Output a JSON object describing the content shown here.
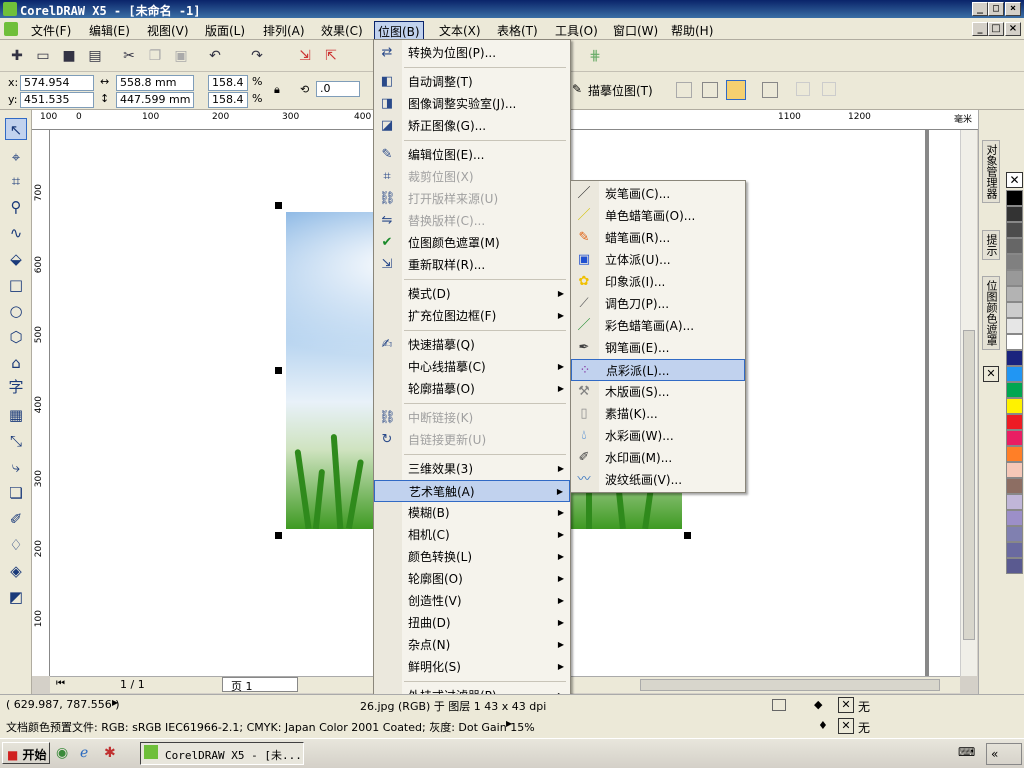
{
  "window": {
    "title": "CorelDRAW X5 - [未命名 -1]"
  },
  "menubar": [
    "文件(F)",
    "编辑(E)",
    "视图(V)",
    "版面(L)",
    "排列(A)",
    "效果(C)",
    "位图(B)",
    "文本(X)",
    "表格(T)",
    "工具(O)",
    "窗口(W)",
    "帮助(H)"
  ],
  "propbar": {
    "x": "574.954 mm",
    "y": "451.535 mm",
    "w": "558.8 mm",
    "h": "447.599 mm",
    "sx": "158.4",
    "sy": "158.4",
    "pct": "%",
    "rot": ".0",
    "trace": "描摹位图(T)"
  },
  "ruler_h": [
    "100",
    "0",
    "100",
    "200",
    "300",
    "400",
    "1100",
    "1200",
    "毫米"
  ],
  "ruler_v": [
    "700",
    "600",
    "500",
    "400",
    "300",
    "200",
    "100"
  ],
  "bitmap_menu": [
    {
      "label": "转换为位图(P)...",
      "icon": "convert-icon",
      "state": "normal"
    },
    {
      "label": "自动调整(T)",
      "icon": "auto-adjust-icon",
      "state": "normal"
    },
    {
      "label": "图像调整实验室(J)...",
      "icon": "image-lab-icon",
      "state": "normal"
    },
    {
      "label": "矫正图像(G)...",
      "icon": "straighten-icon",
      "state": "normal"
    },
    {
      "label": "编辑位图(E)...",
      "icon": "edit-bitmap-icon",
      "state": "normal"
    },
    {
      "label": "裁剪位图(X)",
      "icon": "crop-icon",
      "state": "disabled"
    },
    {
      "label": "打开版样来源(U)",
      "icon": "link-icon",
      "state": "disabled"
    },
    {
      "label": "替换版样(C)...",
      "icon": "replace-icon",
      "state": "disabled"
    },
    {
      "label": "位图颜色遮罩(M)",
      "icon": "check-icon",
      "state": "normal"
    },
    {
      "label": "重新取样(R)...",
      "icon": "resample-icon",
      "state": "normal"
    },
    {
      "label": "模式(D)",
      "icon": "",
      "state": "sub"
    },
    {
      "label": "扩充位图边框(F)",
      "icon": "",
      "state": "sub"
    },
    {
      "label": "快速描摹(Q)",
      "icon": "quick-trace-icon",
      "state": "normal"
    },
    {
      "label": "中心线描摹(C)",
      "icon": "",
      "state": "sub"
    },
    {
      "label": "轮廓描摹(O)",
      "icon": "",
      "state": "sub"
    },
    {
      "label": "中断链接(K)",
      "icon": "break-link-icon",
      "state": "disabled"
    },
    {
      "label": "自链接更新(U)",
      "icon": "update-link-icon",
      "state": "disabled"
    },
    {
      "label": "三维效果(3)",
      "icon": "",
      "state": "sub"
    },
    {
      "label": "艺术笔触(A)",
      "icon": "",
      "state": "highlighted"
    },
    {
      "label": "模糊(B)",
      "icon": "",
      "state": "sub"
    },
    {
      "label": "相机(C)",
      "icon": "",
      "state": "sub"
    },
    {
      "label": "颜色转换(L)",
      "icon": "",
      "state": "sub"
    },
    {
      "label": "轮廓图(O)",
      "icon": "",
      "state": "sub"
    },
    {
      "label": "创造性(V)",
      "icon": "",
      "state": "sub"
    },
    {
      "label": "扭曲(D)",
      "icon": "",
      "state": "sub"
    },
    {
      "label": "杂点(N)",
      "icon": "",
      "state": "sub"
    },
    {
      "label": "鲜明化(S)",
      "icon": "",
      "state": "sub"
    },
    {
      "label": "外挂式过滤器(P)",
      "icon": "",
      "state": "sub"
    }
  ],
  "art_menu": [
    {
      "label": "炭笔画(C)...",
      "icon": "charcoal-icon",
      "color": "#222222"
    },
    {
      "label": "单色蜡笔画(O)...",
      "icon": "crayon-icon",
      "color": "#d4c000"
    },
    {
      "label": "蜡笔画(R)...",
      "icon": "pastel-icon",
      "color": "#e06010"
    },
    {
      "label": "立体派(U)...",
      "icon": "cubist-icon",
      "color": "#2050d0"
    },
    {
      "label": "印象派(I)...",
      "icon": "impressionist-icon",
      "color": "#f0c000"
    },
    {
      "label": "调色刀(P)...",
      "icon": "palette-knife-icon",
      "color": "#606060"
    },
    {
      "label": "彩色蜡笔画(A)...",
      "icon": "color-crayon-icon",
      "color": "#1a8a2a"
    },
    {
      "label": "钢笔画(E)...",
      "icon": "pen-icon",
      "color": "#404040"
    },
    {
      "label": "点彩派(L)...",
      "icon": "pointillist-icon",
      "color": "#8030a0"
    },
    {
      "label": "木版画(S)...",
      "icon": "woodcut-icon",
      "color": "#808080"
    },
    {
      "label": "素描(K)...",
      "icon": "sketch-icon",
      "color": "#909090"
    },
    {
      "label": "水彩画(W)...",
      "icon": "watercolor-icon",
      "color": "#2070d0"
    },
    {
      "label": "水印画(M)...",
      "icon": "watermark-icon",
      "color": "#404040"
    },
    {
      "label": "波纹纸画(V)...",
      "icon": "vignette-icon",
      "color": "#3070c0"
    }
  ],
  "art_highlight_index": 8,
  "docker_tabs": [
    "对象管理器",
    "提示",
    "位图颜色遮罩"
  ],
  "palette": [
    "#000000",
    "#333333",
    "#4d4d4d",
    "#666666",
    "#808080",
    "#999999",
    "#b3b3b3",
    "#cccccc",
    "#e6e6e6",
    "#ffffff",
    "#1a237e",
    "#2196f3",
    "#00a651",
    "#fff200",
    "#ed1c24",
    "#e91e63",
    "#ff7f27",
    "#f5c8b8",
    "#8d6e63",
    "#c0b6d8",
    "#9c8fc8",
    "#8080b0",
    "#6a6aa0",
    "#5a5a90"
  ],
  "page_nav": {
    "count": "1 / 1",
    "tab": "页 1"
  },
  "status": {
    "coords": "( 629.987, 787.556 )",
    "object": "26.jpg (RGB) 于 图层 1 43 x 43 dpi",
    "fill": "无",
    "outline": "无",
    "profile": "文档颜色预置文件: RGB: sRGB IEC61966-2.1; CMYK: Japan Color 2001 Coated; 灰度: Dot Gain 15%"
  },
  "taskbar": {
    "start": "开始",
    "task": "CorelDRAW X5 - [未..."
  }
}
